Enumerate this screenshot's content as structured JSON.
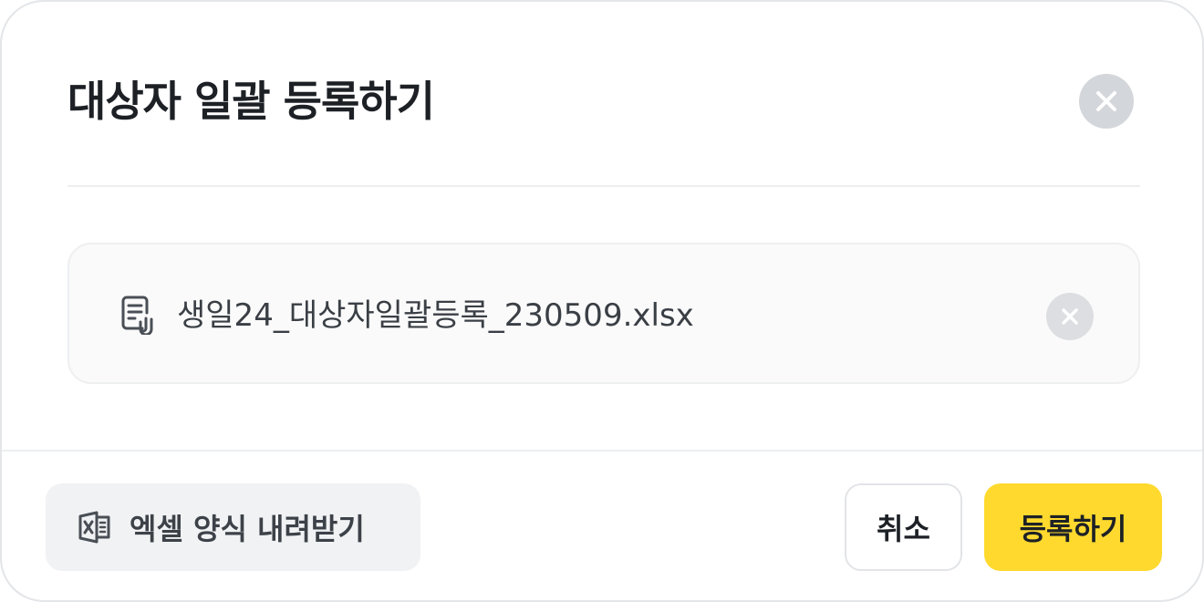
{
  "dialog": {
    "title": "대상자 일괄 등록하기",
    "close_icon": "close-icon"
  },
  "file": {
    "name": "생일24_대상자일괄등록_230509.xlsx",
    "icon": "file-attachment-icon",
    "remove_icon": "close-icon"
  },
  "footer": {
    "download_label": "엑셀 양식 내려받기",
    "download_icon": "excel-icon",
    "cancel_label": "취소",
    "submit_label": "등록하기"
  },
  "colors": {
    "primary_button": "#ffd92e",
    "secondary_button": "#f1f2f4",
    "close_button": "#d3d6da",
    "title_text": "#1d2126"
  }
}
